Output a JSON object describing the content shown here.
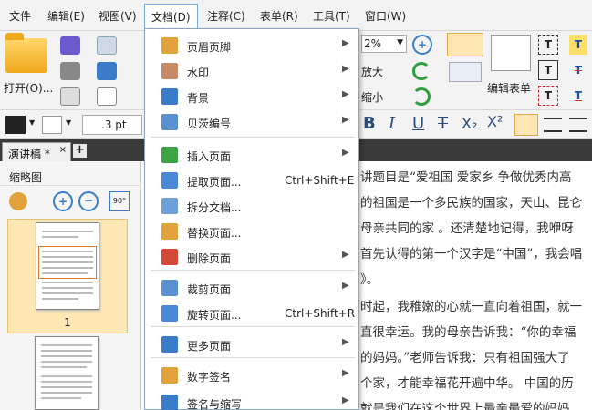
{
  "menubar": {
    "items": [
      "文件",
      "编辑(E)",
      "视图(V)",
      "文档(D)",
      "注释(C)",
      "表单(R)",
      "工具(T)",
      "窗口(W)"
    ]
  },
  "ribbon": {
    "open_label": "打开(O)...",
    "zoom_value": "2%",
    "enlarge_label": "放大",
    "shrink_label": "缩小",
    "edit_form_label": "编辑表单"
  },
  "formatbar": {
    "stroke_width": ".3 pt",
    "bold": "B",
    "italic": "I",
    "underline": "U",
    "strike": "T",
    "subscript": "X₂",
    "superscript": "X²"
  },
  "tabs": {
    "doc_tab": "演讲稿 *",
    "close": "×",
    "add": "+"
  },
  "thumbnails": {
    "title": "缩略图",
    "page_label": "1"
  },
  "document": {
    "lines": [
      "讲题目是“爱祖国 爱家乡 争做优秀内高",
      "的祖国是一个多民族的国家，天山、昆仑",
      "母亲共同的家 。还清楚地记得，我咿呀",
      "首先认得的第一个汉字是“中国”，我会唱",
      "》。",
      "时起，我稚嫩的心就一直向着祖国，就一",
      "直很幸运。我的母亲告诉我：“你的幸福",
      "的妈妈。”老师告诉我：只有祖国强大了",
      "个家，才能幸福花开遍中华。 中国的历",
      "就是我们在这个世界上最亲最爱的妈妈"
    ]
  },
  "dropdown": {
    "items": [
      {
        "label": "页眉页脚",
        "shortcut": "",
        "submenu": true,
        "icon": "header-footer-icon",
        "color": "#e2a23c"
      },
      {
        "label": "水印",
        "shortcut": "",
        "submenu": true,
        "icon": "watermark-icon",
        "color": "#c98a6a"
      },
      {
        "label": "背景",
        "shortcut": "",
        "submenu": true,
        "icon": "background-icon",
        "color": "#3a7cc7"
      },
      {
        "label": "贝茨编号",
        "shortcut": "",
        "submenu": true,
        "icon": "bates-number-icon",
        "color": "#5a8fd0"
      },
      {
        "label": "插入页面",
        "shortcut": "",
        "submenu": true,
        "icon": "insert-page-icon",
        "color": "#3ca447"
      },
      {
        "label": "提取页面...",
        "shortcut": "Ctrl+Shift+E",
        "submenu": false,
        "icon": "extract-page-icon",
        "color": "#4a87d4"
      },
      {
        "label": "拆分文档...",
        "shortcut": "",
        "submenu": false,
        "icon": "split-document-icon",
        "color": "#6f9fd8"
      },
      {
        "label": "替换页面...",
        "shortcut": "",
        "submenu": false,
        "icon": "replace-page-icon",
        "color": "#e2a23c"
      },
      {
        "label": "删除页面",
        "shortcut": "",
        "submenu": true,
        "icon": "delete-page-icon",
        "color": "#d34a3a"
      },
      {
        "label": "裁剪页面",
        "shortcut": "",
        "submenu": true,
        "icon": "crop-page-icon",
        "color": "#5a8fd0"
      },
      {
        "label": "旋转页面...",
        "shortcut": "Ctrl+Shift+R",
        "submenu": false,
        "icon": "rotate-page-icon",
        "color": "#4a87d4"
      },
      {
        "label": "更多页面",
        "shortcut": "",
        "submenu": true,
        "icon": "more-pages-icon",
        "color": "#3a7cc7"
      },
      {
        "label": "数字签名",
        "shortcut": "",
        "submenu": true,
        "icon": "digital-signature-icon",
        "color": "#e2a23c"
      },
      {
        "label": "签名与缩写",
        "shortcut": "",
        "submenu": true,
        "icon": "signature-icon",
        "color": "#3a7cc7"
      }
    ],
    "arrow": "▶"
  }
}
